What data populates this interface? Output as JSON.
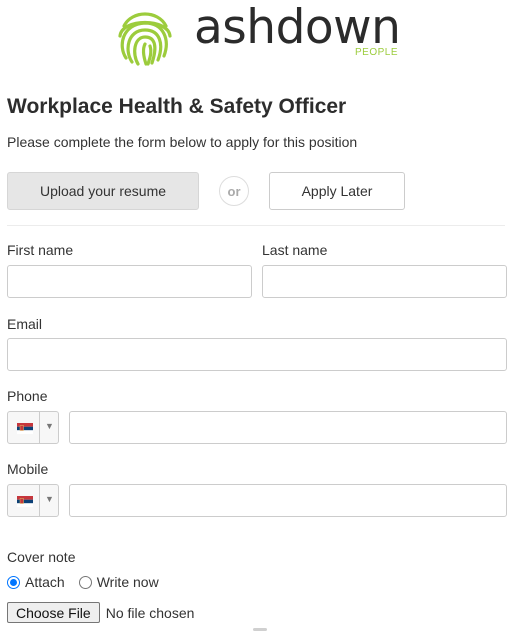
{
  "brand": {
    "wordmark": "ashdown",
    "sub": "PEOPLE",
    "logo_icon": "fingerprint-icon",
    "logo_color": "#9ccc3c"
  },
  "job": {
    "title": "Workplace Health & Safety Officer",
    "intro": "Please complete the form below to apply for this position"
  },
  "actions": {
    "upload_label": "Upload your resume",
    "or_label": "or",
    "later_label": "Apply Later"
  },
  "form": {
    "first_name": {
      "label": "First name",
      "value": ""
    },
    "last_name": {
      "label": "Last name",
      "value": ""
    },
    "email": {
      "label": "Email",
      "value": ""
    },
    "phone": {
      "label": "Phone",
      "country_flag": "serbia-flag-icon",
      "value": ""
    },
    "mobile": {
      "label": "Mobile",
      "country_flag": "serbia-flag-icon",
      "value": ""
    },
    "cover_note": {
      "label": "Cover note",
      "options": [
        "Attach",
        "Write now"
      ],
      "selected": "Attach",
      "file_button": "Choose File",
      "file_status": "No file chosen"
    }
  }
}
